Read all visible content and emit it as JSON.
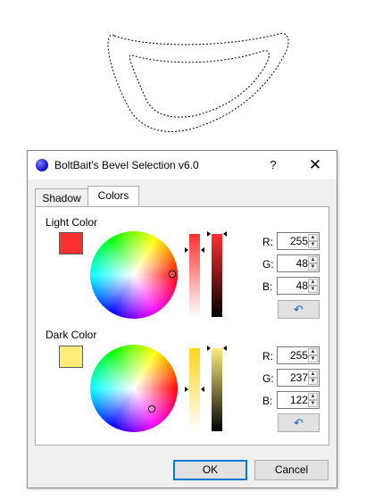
{
  "dialog": {
    "title": "BoltBait's Bevel Selection v6.0",
    "help_label": "?",
    "close_label": "✕",
    "icons": {
      "app": "blue-sphere-icon",
      "help": "question-mark",
      "close": "x-icon"
    }
  },
  "tabs": [
    {
      "label": "Shadow",
      "active": false
    },
    {
      "label": "Colors",
      "active": true
    }
  ],
  "light_color": {
    "label": "Light Color",
    "swatch_hex": "#ff3030",
    "r_label": "R:",
    "g_label": "G:",
    "b_label": "B:",
    "r": "255",
    "g": "48",
    "b": "48",
    "saturation_level": 0.81,
    "value_level": 1.0,
    "reset_icon": "undo-arrow-icon",
    "reset_glyph": "↶"
  },
  "dark_color": {
    "label": "Dark Color",
    "swatch_hex": "#ffed7a",
    "r_label": "R:",
    "g_label": "G:",
    "b_label": "B:",
    "r": "255",
    "g": "237",
    "b": "122",
    "saturation_level": 0.52,
    "value_level": 1.0,
    "reset_icon": "undo-arrow-icon",
    "reset_glyph": "↶"
  },
  "buttons": {
    "ok": "OK",
    "cancel": "Cancel"
  },
  "colors": {
    "accent": "#0078d7",
    "selection_outline": "#000000"
  }
}
